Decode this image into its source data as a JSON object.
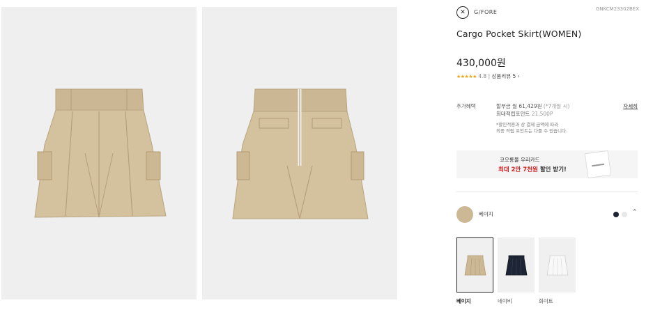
{
  "brand": {
    "name": "G/FORE",
    "product_code": "GNKCM23302BEX"
  },
  "product": {
    "title": "Cargo Pocket Skirt(WOMEN)",
    "price": "430,000원",
    "rating": {
      "stars": "★★★★★",
      "score": "4.8",
      "separator": "|",
      "review_label": "상품리뷰 5",
      "arrow": "›"
    }
  },
  "benefit": {
    "label": "추가혜택",
    "installment": "할부금 월 61,429원",
    "installment_note": "(*7개월 시)",
    "points_label": "최대적립포인트",
    "points_value": "21,500P",
    "note_line1": "*할인적용과 상 결제 금액에 따라",
    "note_line2": "최종 적립 포인트는 다를 수 있습니다.",
    "detail_link": "자세히"
  },
  "card_banner": {
    "line1": "코오롱몰 우리카드",
    "line2_highlight": "최대 2만 7천원",
    "line2_rest": " 할인 받기!"
  },
  "color_selector": {
    "selected_name": "베이지",
    "selected_color": "#cdb896",
    "chevron": "⌃"
  },
  "variants": [
    {
      "label": "베이지",
      "color": "#cdb896",
      "selected": true
    },
    {
      "label": "네이비",
      "color": "#1d2433",
      "selected": false
    },
    {
      "label": "화이트",
      "color": "#f2f2f2",
      "selected": false
    }
  ]
}
